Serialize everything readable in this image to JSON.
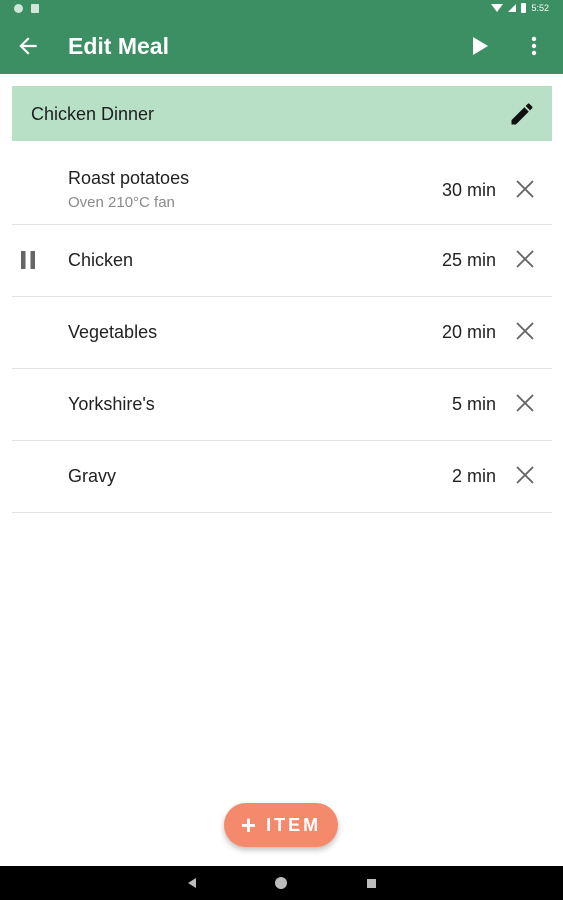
{
  "status_bar": {
    "time": "5:52"
  },
  "app_bar": {
    "title": "Edit Meal"
  },
  "meal": {
    "name": "Chicken Dinner"
  },
  "items": [
    {
      "name": "Roast potatoes",
      "note": "Oven 210°C fan",
      "time": "30 min",
      "paused": false
    },
    {
      "name": "Chicken",
      "note": "",
      "time": "25 min",
      "paused": true
    },
    {
      "name": "Vegetables",
      "note": "",
      "time": "20 min",
      "paused": false
    },
    {
      "name": "Yorkshire's",
      "note": "",
      "time": "5 min",
      "paused": false
    },
    {
      "name": "Gravy",
      "note": "",
      "time": "2 min",
      "paused": false
    }
  ],
  "fab": {
    "plus": "+",
    "label": "ITEM"
  },
  "colors": {
    "primary": "#3b8f63",
    "header_bg": "#b8e0c6",
    "fab": "#f5896b"
  },
  "icons": {
    "back": "arrow-left-icon",
    "play": "play-icon",
    "more": "more-vert-icon",
    "edit": "pencil-icon",
    "delete": "close-icon",
    "pause": "pause-icon"
  }
}
